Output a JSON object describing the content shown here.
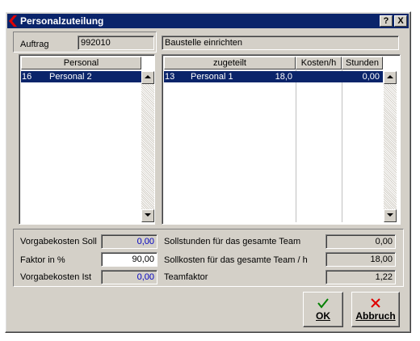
{
  "window": {
    "title": "Personalzuteilung",
    "help_btn": "?",
    "close_btn": "X"
  },
  "auftrag": {
    "label": "Auftrag",
    "value": "992010",
    "description": "Baustelle einrichten"
  },
  "personal_list": {
    "header": "Personal",
    "rows": [
      {
        "nr": "16",
        "name": "Personal 2"
      }
    ]
  },
  "assigned_list": {
    "headers": {
      "name": "zugeteilt",
      "kosten": "Kosten/h",
      "stunden": "Stunden"
    },
    "rows": [
      {
        "nr": "13",
        "name": "Personal 1",
        "kosten": "18,0",
        "stunden": "0,00"
      }
    ]
  },
  "summary": {
    "vorgabekosten_soll": {
      "label": "Vorgabekosten Soll",
      "value": "0,00"
    },
    "faktor": {
      "label": "Faktor in %",
      "value": "90,00"
    },
    "vorgabekosten_ist": {
      "label": "Vorgabekosten Ist",
      "value": "0,00"
    },
    "sollstunden": {
      "label": "Sollstunden für das gesamte Team",
      "value": "0,00"
    },
    "sollkosten": {
      "label": "Sollkosten für das gesamte Team / h",
      "value": "18,00"
    },
    "teamfaktor": {
      "label": "Teamfaktor",
      "value": "1,22"
    }
  },
  "buttons": {
    "ok": "OK",
    "abbruch": "Abbruch"
  },
  "colors": {
    "titlebar": "#0a246a",
    "selection": "#0a246a",
    "face": "#d4d0c8",
    "ok_icon": "#008000",
    "cancel_icon": "#e00000",
    "value_blue": "#0000c0"
  }
}
